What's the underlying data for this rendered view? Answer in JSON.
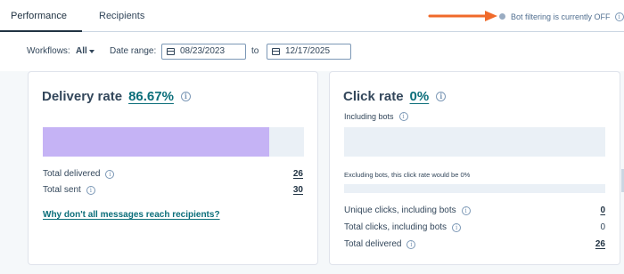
{
  "tabs": [
    {
      "label": "Performance",
      "active": true
    },
    {
      "label": "Recipients",
      "active": false
    }
  ],
  "bot_filter": {
    "text": "Bot filtering is currently OFF",
    "status_color": "#99acc2",
    "info_icon": "info-icon"
  },
  "annotation": {
    "arrow_color": "#f06a2a"
  },
  "filters": {
    "workflows_label": "Workflows:",
    "workflows_value": "All",
    "date_range_label": "Date range:",
    "date_from": "08/23/2023",
    "to_label": "to",
    "date_to": "12/17/2025"
  },
  "delivery": {
    "title": "Delivery rate",
    "rate": "86.67%",
    "bar_fill_percent": 86.67,
    "bar_color": "#c5b3f5",
    "total_delivered_label": "Total delivered",
    "total_delivered_value": "26",
    "total_sent_label": "Total sent",
    "total_sent_value": "30",
    "help_link": "Why don't all messages reach recipients?"
  },
  "click": {
    "title": "Click rate",
    "rate": "0%",
    "including_bots_label": "Including bots",
    "excluding_note": "Excluding bots, this click rate would be 0%",
    "unique_clicks_label": "Unique clicks, including bots",
    "unique_clicks_value": "0",
    "total_clicks_label": "Total clicks, including bots",
    "total_clicks_value": "0",
    "total_delivered_label": "Total delivered",
    "total_delivered_value": "26"
  },
  "colors": {
    "accent": "#0b6e7a",
    "text": "#33475b",
    "border": "#cbd6e2"
  }
}
